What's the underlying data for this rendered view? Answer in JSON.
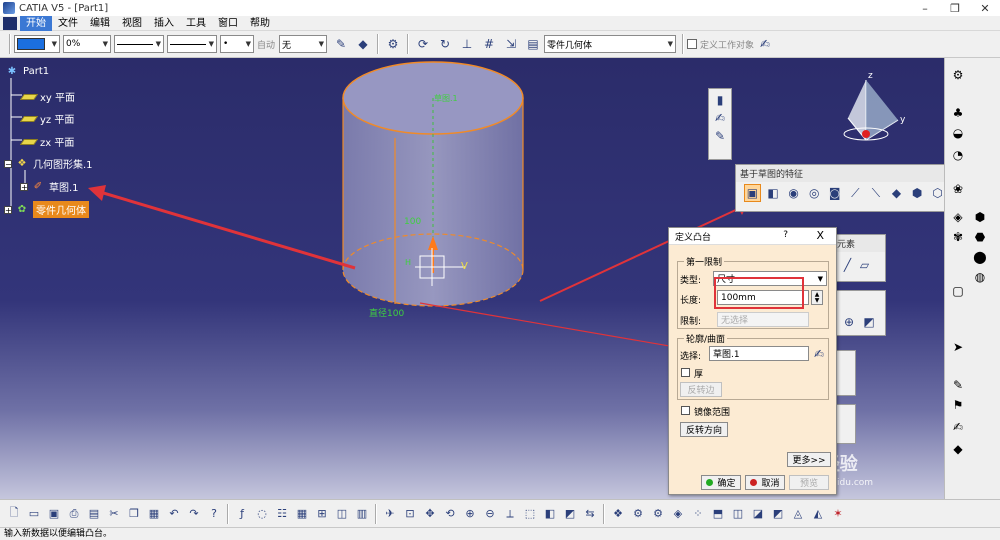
{
  "window": {
    "title": "CATIA V5 - [Part1]",
    "min": "–",
    "max": "❐",
    "close": "✕"
  },
  "menu": [
    "开始",
    "文件",
    "编辑",
    "视图",
    "插入",
    "工具",
    "窗口",
    "帮助"
  ],
  "props": {
    "transparency": "0%",
    "layer_label": "自动",
    "layer_value": "无",
    "body_combo": "零件几何体",
    "work_object_label": "定义工作对象"
  },
  "tree": {
    "root": "Part1",
    "xy": "xy 平面",
    "yz": "yz 平面",
    "zx": "zx 平面",
    "geoset": "几何图形集.1",
    "sketch": "草图.1",
    "body": "零件几何体"
  },
  "model": {
    "height_label": "100",
    "diameter_label": "直径100",
    "top_label": "草图.1",
    "v_label": "V",
    "h_label": "H",
    "axis_z": "z",
    "axis_y": "y"
  },
  "sketch_toolbar": {
    "title": "基于草图的特征"
  },
  "partial_labels": {
    "element": "元素"
  },
  "dialog": {
    "title": "定义凸台",
    "help": "?",
    "close": "X",
    "first_limit": "第一限制",
    "type_label": "类型:",
    "type_value": "尺寸",
    "length_label": "长度:",
    "length_value": "100mm",
    "limit_label": "限制:",
    "limit_value": "无选择",
    "profile_group": "轮廓/曲面",
    "select_label": "选择:",
    "select_value": "草图.1",
    "thick_label": "厚",
    "reverse_side": "反转边",
    "mirror_label": "镜像范围",
    "reverse_dir": "反转方向",
    "more": "更多>>",
    "ok": "确定",
    "cancel": "取消",
    "preview": "预览"
  },
  "watermark": {
    "brand": "Baidu经验",
    "url": "jingyan.baidu.com"
  },
  "status": "输入新数据以便编辑凸台。",
  "colors": {
    "tree_highlight": "#e8891c",
    "annotation_red": "#e0333a",
    "cylinder_edge": "#f08a28"
  }
}
